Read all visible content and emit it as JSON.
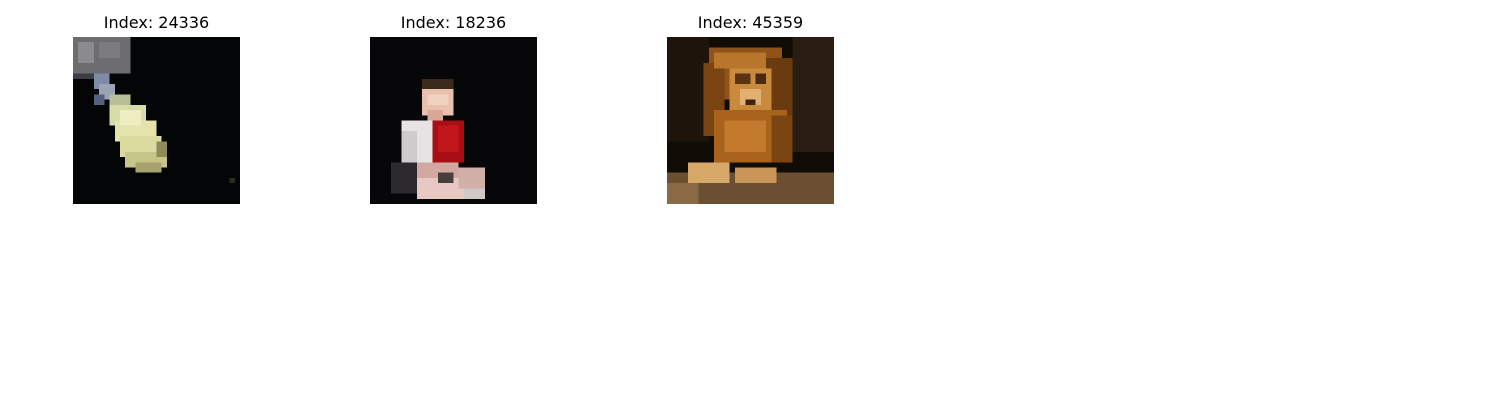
{
  "panels": [
    {
      "title": "Index: 24336",
      "subject": "pale yellow oval object on black background"
    },
    {
      "title": "Index: 18236",
      "subject": "child in red shirt seated on dark background"
    },
    {
      "title": "Index: 45359",
      "subject": "lion resting, front view"
    }
  ],
  "colors": {
    "background": "#ffffff",
    "image_backdrop": "#050505",
    "lion_mane": "#a8621c",
    "shirt_red": "#a80f14"
  }
}
